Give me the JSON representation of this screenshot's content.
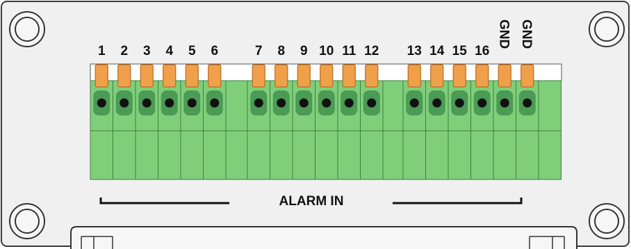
{
  "panel": {
    "title": "ALARM IN",
    "colors": {
      "panel_fill": "#f0f0f1",
      "panel_border": "#3a3a3a",
      "terminal_green": "#7fcf7a",
      "terminal_dark_green": "#4b9a55",
      "lever_orange": "#f0a04b",
      "lever_border": "#b86a1e",
      "hole_black": "#111111"
    }
  },
  "blocks": [
    {
      "pins": [
        {
          "label": "1"
        },
        {
          "label": "2"
        },
        {
          "label": "3"
        },
        {
          "label": "4"
        },
        {
          "label": "5"
        },
        {
          "label": "6"
        }
      ]
    },
    {
      "pins": [
        {
          "label": "7"
        },
        {
          "label": "8"
        },
        {
          "label": "9"
        },
        {
          "label": "10"
        },
        {
          "label": "11"
        },
        {
          "label": "12"
        }
      ]
    },
    {
      "pins": [
        {
          "label": "13"
        },
        {
          "label": "14"
        },
        {
          "label": "15"
        },
        {
          "label": "16"
        },
        {
          "label": "GND",
          "vertical": true
        },
        {
          "label": "GND",
          "vertical": true
        }
      ]
    }
  ],
  "mounting_holes": [
    {
      "name": "top-left"
    },
    {
      "name": "top-right"
    },
    {
      "name": "bottom-left"
    },
    {
      "name": "bottom-right"
    }
  ]
}
